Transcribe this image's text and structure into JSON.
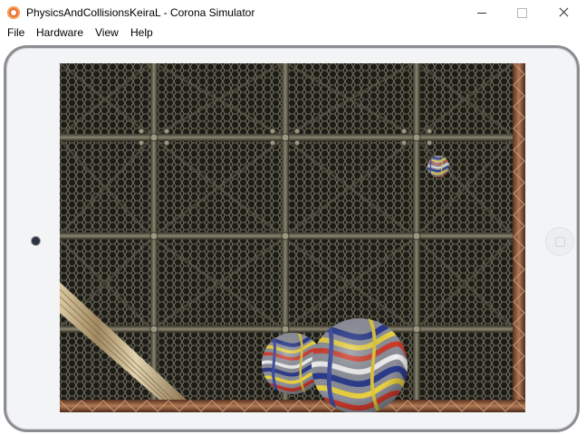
{
  "window": {
    "title": "PhysicsAndCollisionsKeiraL - Corona Simulator",
    "minimize_glyph": "",
    "maximize_glyph": "",
    "close_glyph": ""
  },
  "menu": {
    "items": [
      "File",
      "Hardware",
      "View",
      "Help"
    ]
  },
  "icons": {
    "app": "corona-simulator-icon",
    "camera": "camera-icon",
    "home": "home-button-icon"
  },
  "colors": {
    "device_frame": "#8b8d91",
    "device_body": "#f3f4f6",
    "screen_background": "#1e1d18",
    "mesh": "#6b6a5a",
    "frame_rust": "#8a5a3c",
    "plank": "#c8b48a"
  }
}
